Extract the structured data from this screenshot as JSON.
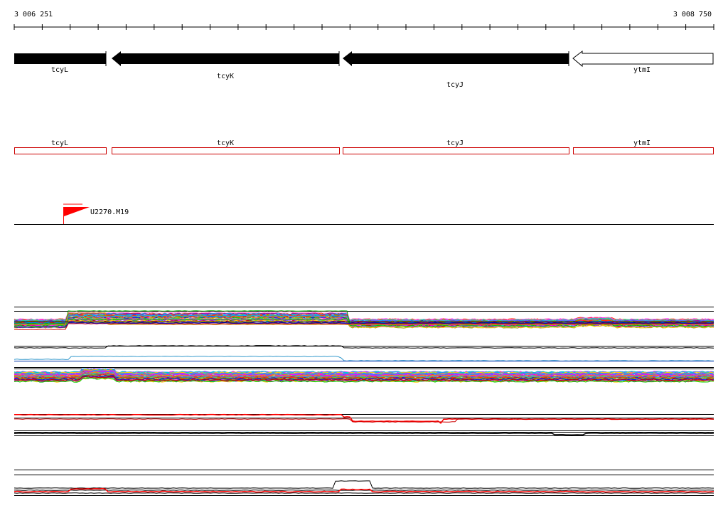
{
  "coords": {
    "start_label": "3 006 251",
    "end_label": "3 008 750"
  },
  "genes": [
    {
      "name": "tcyL",
      "strand": "forward",
      "style": "filled"
    },
    {
      "name": "tcyK",
      "strand": "reverse",
      "style": "filled"
    },
    {
      "name": "tcyJ",
      "strand": "reverse",
      "style": "filled"
    },
    {
      "name": "ytmI",
      "strand": "reverse",
      "style": "outline"
    }
  ],
  "feature_boxes": [
    "tcyL",
    "tcyK",
    "tcyJ",
    "ytmI"
  ],
  "marker": {
    "label": "U2270.M19",
    "color": "#ff0000"
  },
  "colors": {
    "box_outline": "#cc0000",
    "gene_fill": "#000000",
    "marker": "#ff0000"
  }
}
